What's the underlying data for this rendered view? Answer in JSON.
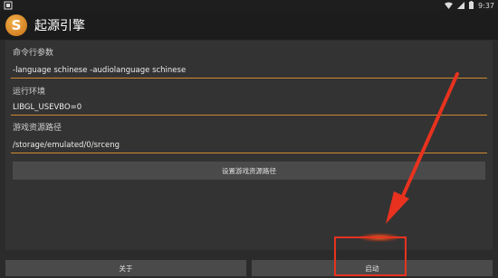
{
  "status": {
    "time": "9:37",
    "icons": [
      "notification-icon",
      "wifi-icon",
      "signal-icon",
      "battery-icon"
    ]
  },
  "app": {
    "logo_letter": "S",
    "title": "起源引擎"
  },
  "fields": [
    {
      "label": "命令行参数",
      "value": "-language schinese -audiolanguage schinese"
    },
    {
      "label": "运行环境",
      "value": "LIBGL_USEVBO=0"
    },
    {
      "label": "游戏资源路径",
      "value": "/storage/emulated/0/srceng"
    }
  ],
  "buttons": {
    "set_path": "设置游戏资源路径",
    "about": "关于",
    "start": "启动"
  },
  "colors": {
    "accent": "#d18a2e",
    "annotation": "#e8321f"
  }
}
